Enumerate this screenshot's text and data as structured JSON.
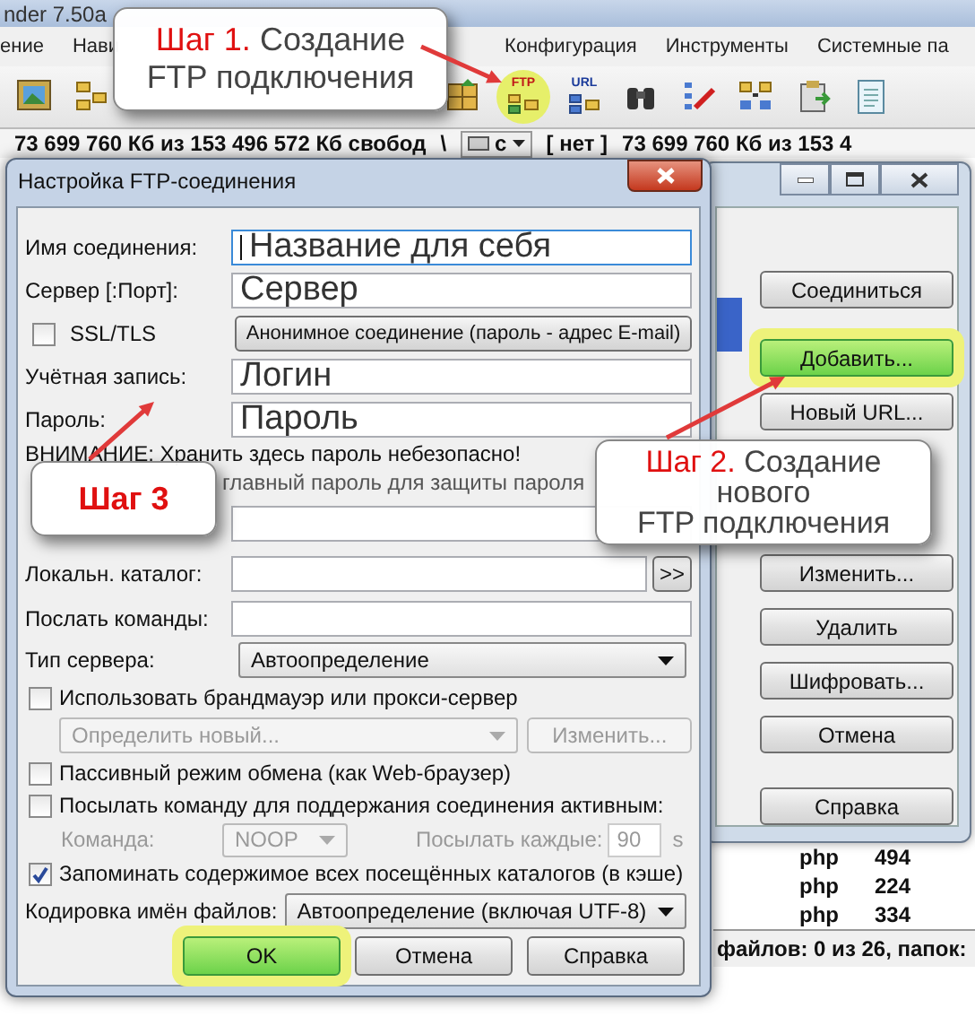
{
  "app": {
    "title": "nder 7.50a",
    "menu": [
      {
        "label": "ение"
      },
      {
        "label": "Нави"
      },
      {
        "kind": "covered"
      },
      {
        "label": "Конфигурация"
      },
      {
        "label": "Инструменты"
      },
      {
        "label": "Системные па"
      }
    ],
    "toolbar": [
      {
        "kind": "picture"
      },
      {
        "kind": "tree"
      },
      {
        "kind": "covered"
      },
      {
        "kind": "grid"
      },
      {
        "kind": "ftp",
        "label": "FTP",
        "highlighted": true
      },
      {
        "kind": "url",
        "label": "URL"
      },
      {
        "kind": "binoculars"
      },
      {
        "kind": "edit"
      },
      {
        "kind": "sync"
      },
      {
        "kind": "clipboard"
      },
      {
        "kind": "notepad"
      }
    ],
    "drive_bar": {
      "left_free": "73 699 760 Кб из 153 496 572 Кб свобод",
      "left_path": "\\",
      "drive": "c",
      "right_label": "[ нет ]",
      "right_free": "73 699 760 Кб из 153 4"
    }
  },
  "connections_window": {
    "buttons": [
      {
        "kind": "button",
        "label": "Соединиться"
      },
      {
        "kind": "button",
        "label": "Добавить...",
        "highlighted": true
      },
      {
        "kind": "button",
        "label": "Новый URL..."
      },
      {
        "kind": "covered"
      },
      {
        "kind": "covered"
      },
      {
        "kind": "button",
        "label": "Изменить..."
      },
      {
        "kind": "button",
        "label": "Удалить"
      },
      {
        "kind": "button",
        "label": "Шифровать..."
      },
      {
        "kind": "button",
        "label": "Отмена"
      },
      {
        "kind": "separated",
        "label": "Справка"
      }
    ]
  },
  "file_list": {
    "rows": [
      {
        "ext": "php",
        "size": "494"
      },
      {
        "ext": "php",
        "size": "224"
      },
      {
        "ext": "php",
        "size": "334"
      }
    ],
    "status": "файлов: 0 из 26, папок:"
  },
  "dialog": {
    "title": "Настройка FTP-соединения",
    "rows": [
      {
        "kind": "input",
        "label": "Имя соединения:",
        "value": "Название для себя",
        "focused": true
      },
      {
        "kind": "input",
        "label": "Сервер [:Порт]:",
        "value": "Сервер",
        "focused": false
      },
      {
        "kind": "ssl",
        "label": "SSL/TLS",
        "checked": false,
        "button": "Анонимное соединение (пароль - адрес E-mail)"
      },
      {
        "kind": "input",
        "label": "Учётная запись:",
        "value": "Логин",
        "focused": false
      },
      {
        "kind": "input",
        "label": "Пароль:",
        "value": "Пароль",
        "focused": false
      },
      {
        "kind": "note",
        "text": "ВНИМАНИЕ: Хранить здесь пароль небезопасно!"
      },
      {
        "kind": "covered-check",
        "text": "главный пароль для защиты пароля"
      },
      {
        "kind": "blank-input"
      },
      {
        "kind": "browse",
        "label": "Локальн. каталог:",
        "button": ">>"
      },
      {
        "kind": "input",
        "label": "Послать команды:",
        "focused": false
      },
      {
        "kind": "select",
        "label": "Тип сервера:",
        "value": "Автоопределение"
      },
      {
        "kind": "checkbox",
        "label": "Использовать брандмауэр или прокси-сервер",
        "checked": false
      },
      {
        "kind": "proxy",
        "value": "Определить новый...",
        "button": "Изменить...",
        "disabled": true
      },
      {
        "kind": "checkbox",
        "label": "Пассивный режим обмена (как Web-браузер)",
        "checked": false
      },
      {
        "kind": "checkbox",
        "label": "Посылать команду для поддержания соединения активным:",
        "checked": false
      },
      {
        "kind": "keepalive",
        "label": "Команда:",
        "value": "NOOP",
        "interval_label": "Посылать каждые:",
        "interval": "90",
        "unit": "s",
        "disabled": true
      },
      {
        "kind": "checkbox",
        "label": "Запоминать содержимое всех посещённых каталогов (в кэше)",
        "checked": true
      },
      {
        "kind": "select",
        "label": "Кодировка имён файлов:",
        "value": "Автоопределение (включая UTF-8)"
      }
    ],
    "buttons": [
      {
        "label": "OK",
        "highlighted": true
      },
      {
        "label": "Отмена"
      },
      {
        "label": "Справка"
      }
    ]
  },
  "callouts": [
    {
      "step": "Шаг 1.",
      "text": "Создание\nFTP подключения"
    },
    {
      "step": "Шаг 3"
    },
    {
      "step": "Шаг 2.",
      "text": "Создание\nнового\nFTP подключения"
    }
  ]
}
